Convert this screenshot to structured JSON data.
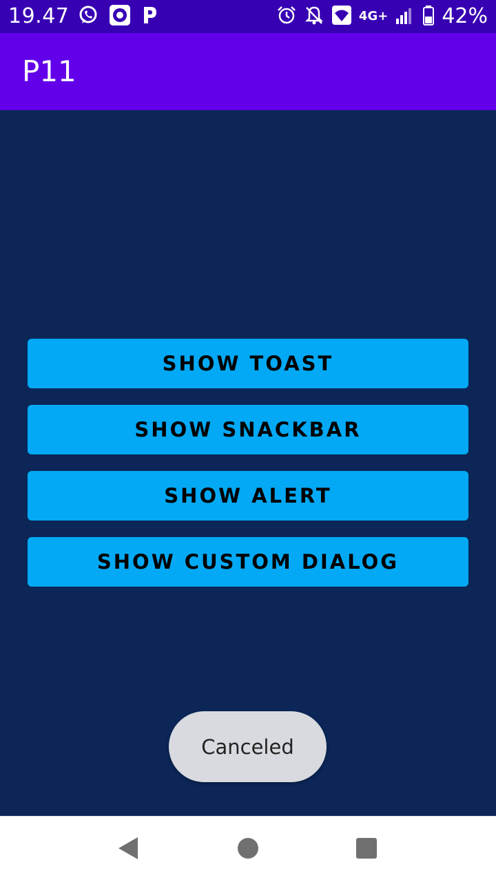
{
  "status_bar": {
    "time": "19.47",
    "network": "4G+",
    "battery": "42%",
    "left_icons": [
      "whatsapp-icon",
      "music-icon",
      "app-p-icon"
    ],
    "right_icons": [
      "alarm-icon",
      "bell-off-icon",
      "wifi-call-icon",
      "signal-icon",
      "battery-icon"
    ]
  },
  "app_bar": {
    "title": "P11"
  },
  "buttons": {
    "show_toast": "SHOW TOAST",
    "show_snackbar": "SHOW SNACKBAR",
    "show_alert": "SHOW ALERT",
    "show_custom_dialog": "SHOW CUSTOM DIALOG"
  },
  "toast": {
    "message": "Canceled"
  },
  "nav_bar": {
    "icons": [
      "back-icon",
      "home-icon",
      "recents-icon"
    ]
  },
  "colors": {
    "status_bar": "#3700b3",
    "app_bar": "#6200ea",
    "background": "#0b2657",
    "button": "#03a9f4",
    "toast": "#d8dadf"
  }
}
